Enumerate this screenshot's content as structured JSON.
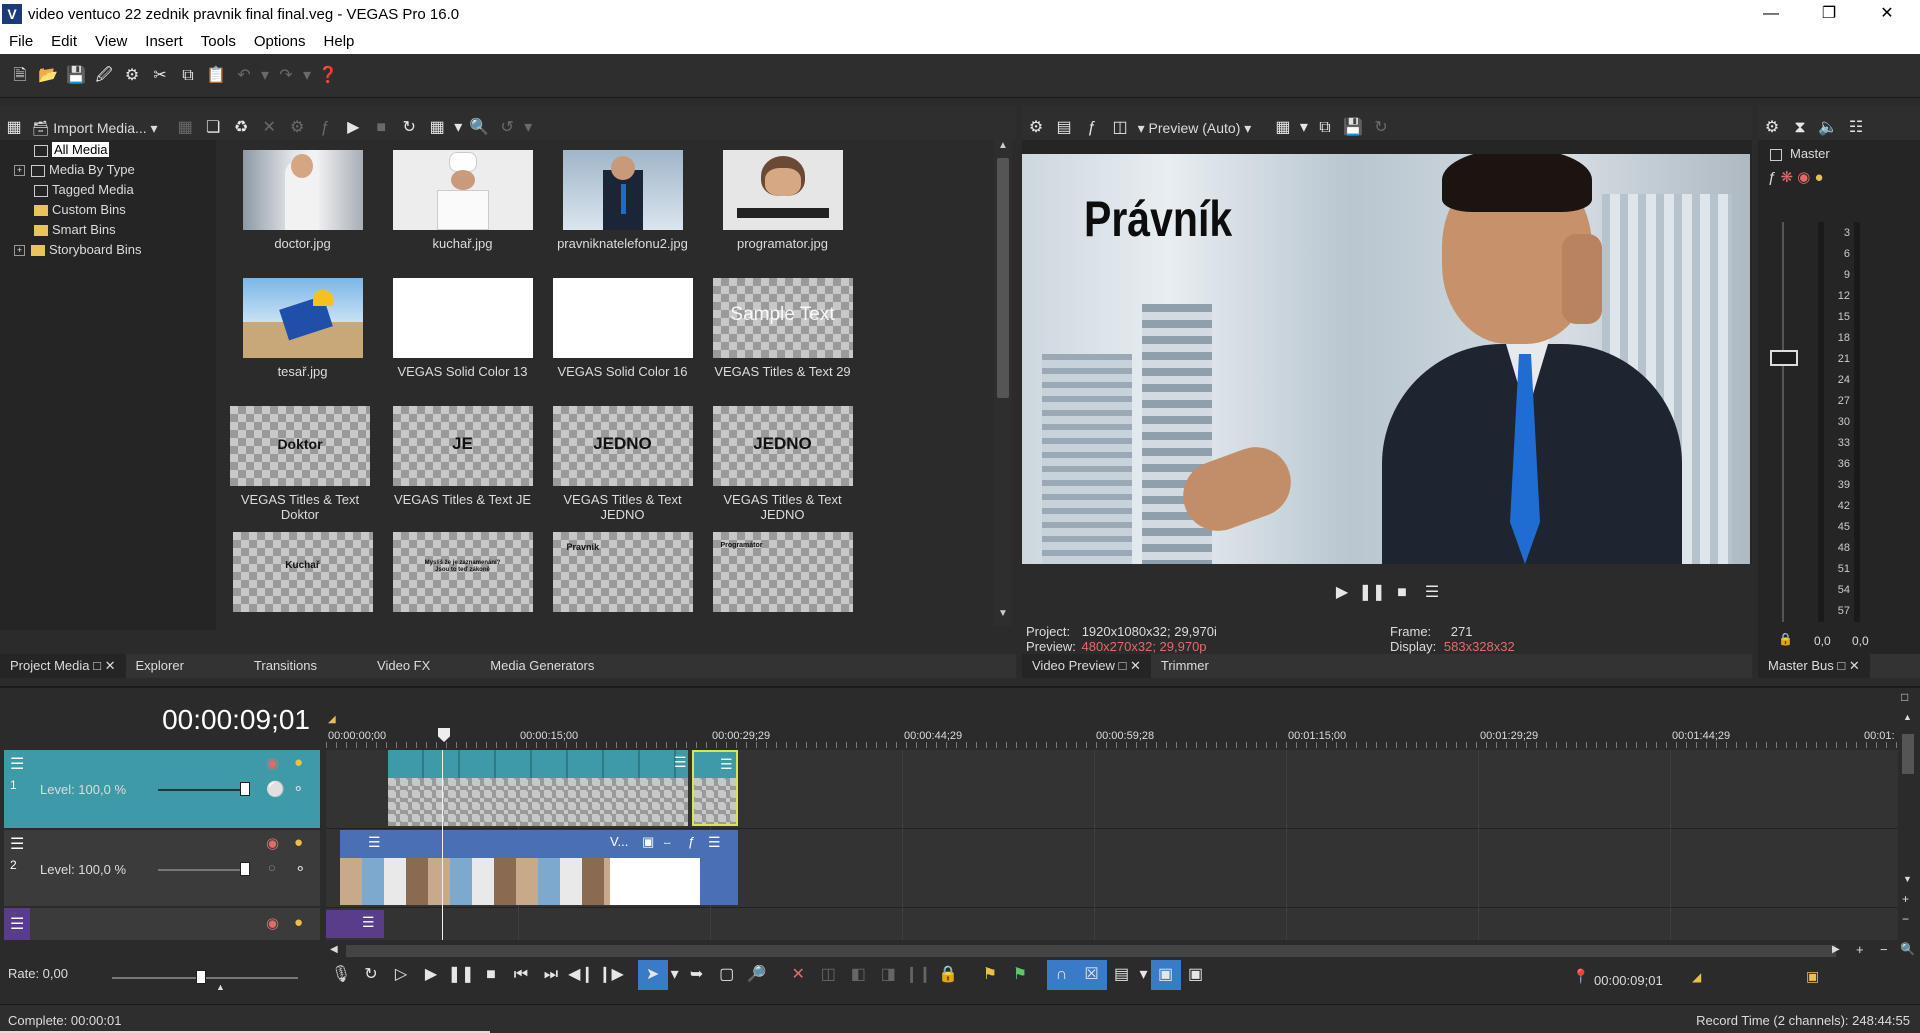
{
  "window": {
    "title": "video ventuco 22 zednik pravnik final final.veg - VEGAS Pro 16.0",
    "logo": "V"
  },
  "menu": [
    "File",
    "Edit",
    "View",
    "Insert",
    "Tools",
    "Options",
    "Help"
  ],
  "media_toolbar": {
    "import_label": "Import Media..."
  },
  "tree": [
    {
      "label": "All Media",
      "selected": true
    },
    {
      "label": "Media By Type",
      "expand": "+"
    },
    {
      "label": "Tagged Media"
    },
    {
      "label": "Custom Bins"
    },
    {
      "label": "Smart Bins"
    },
    {
      "label": "Storyboard Bins",
      "expand": "+"
    }
  ],
  "media": [
    {
      "caption": "doctor.jpg"
    },
    {
      "caption": "kuchař.jpg"
    },
    {
      "caption": "pravniknatelefonu2.jpg"
    },
    {
      "caption": "programator.jpg"
    },
    {
      "caption": "tesař.jpg"
    },
    {
      "caption": "VEGAS Solid Color 13"
    },
    {
      "caption": "VEGAS Solid Color 16"
    },
    {
      "caption": "VEGAS Titles & Text 29",
      "overlay": "Sample Text"
    },
    {
      "caption": "VEGAS Titles & Text Doktor",
      "overlay": "Doktor"
    },
    {
      "caption": "VEGAS Titles & Text JE",
      "overlay": "JE"
    },
    {
      "caption": "VEGAS Titles & Text JEDNO",
      "overlay": "JEDNO"
    },
    {
      "caption": "VEGAS Titles & Text JEDNO",
      "overlay": "JEDNO"
    },
    {
      "caption": "",
      "overlay": "Kuchař"
    },
    {
      "caption": "",
      "overlay": "Myslíš že je zaznamenání? Jsou to teď zákoně"
    },
    {
      "caption": "",
      "overlay": "Pravník"
    },
    {
      "caption": "",
      "overlay": "Programátor"
    }
  ],
  "left_tabs": [
    "Project Media",
    "Explorer",
    "Transitions",
    "Video FX",
    "Media Generators"
  ],
  "preview": {
    "mode": "Preview (Auto)",
    "overlay_text": "Právník",
    "project_label": "Project:",
    "project_value": "1920x1080x32; 29,970i",
    "preview_label": "Preview:",
    "preview_value": "480x270x32; 29,970p",
    "frame_label": "Frame:",
    "frame_value": "271",
    "display_label": "Display:",
    "display_value": "583x328x32",
    "tabs": [
      "Video Preview",
      "Trimmer"
    ]
  },
  "master": {
    "label": "Master",
    "scale": [
      "3",
      "6",
      "9",
      "12",
      "15",
      "18",
      "21",
      "24",
      "27",
      "30",
      "33",
      "36",
      "39",
      "42",
      "45",
      "48",
      "51",
      "54",
      "57"
    ],
    "left_val": "0,0",
    "right_val": "0,0",
    "tab": "Master Bus"
  },
  "timeline": {
    "timecode": "00:00:09;01",
    "ruler": [
      "00:00:00;00",
      "00:00:15;00",
      "00:00:29;29",
      "00:00:44;29",
      "00:00:59;28",
      "00:01:15;00",
      "00:01:29;29",
      "00:01:44;29",
      "00:01:"
    ],
    "tracks": [
      {
        "num": "1",
        "level": "Level: 100,0 %"
      },
      {
        "num": "2",
        "level": "Level: 100,0 %"
      }
    ],
    "clip_label": "V...",
    "rate": "Rate: 0,00",
    "cursor_time": "00:00:09;01"
  },
  "status": {
    "left": "Complete: 00:00:01",
    "right": "Record Time (2 channels): 248:44:55"
  },
  "colors": {
    "accent": "#4a9fd8",
    "track1": "#3f9aa8",
    "track2": "#4a6fb5",
    "track3": "#5a3d8a",
    "warn": "#e46a6a"
  }
}
